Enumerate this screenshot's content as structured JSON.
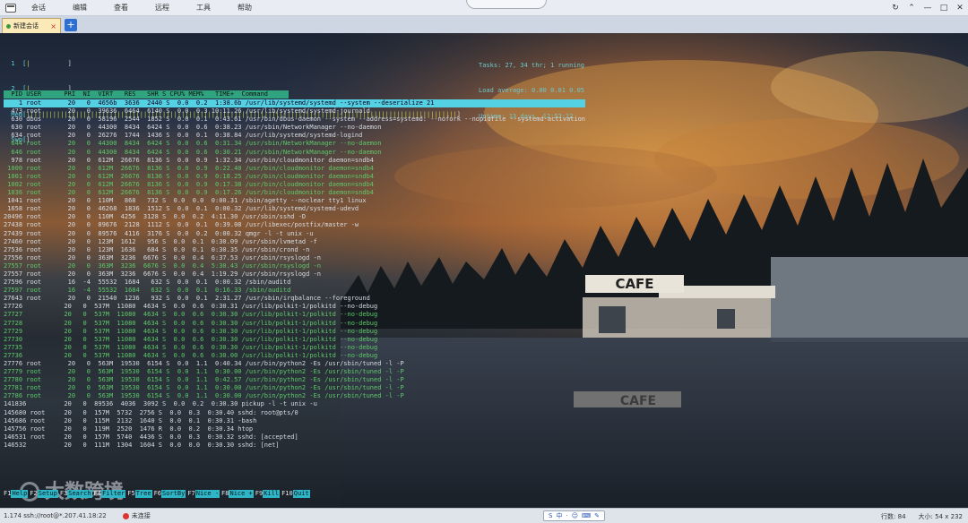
{
  "menu": [
    "会话",
    "编辑",
    "查看",
    "远程",
    "工具",
    "帮助"
  ],
  "tab": {
    "label": "新建会话",
    "close": "×",
    "add": "+"
  },
  "window_controls": [
    "↻",
    "⌃",
    "—",
    "□",
    "✕"
  ],
  "meters": [
    {
      "label": "  1  [",
      "bar": "|",
      "end": "          ]"
    },
    {
      "label": "  2  [",
      "bar": "|",
      "end": "          ]"
    },
    {
      "label": "  Mem[",
      "bar": "||||||||||||||||||||||||||||||||||||||||||||||||||||||||||||||||||||||||||||||||||||||||||||||||||||||||||||||||||",
      "end": "]"
    },
    {
      "label": "  Swp[",
      "bar": "",
      "end": "]"
    }
  ],
  "summary": [
    "Tasks: 27, 34 thr; 1 running",
    "Load average: 0.00 0.01 0.05",
    "Uptime: 13 days, 12:52:12"
  ],
  "process_header": "  PID USER      PRI  NI  VIRT   RES   SHR S CPU% MEM%   TIME+  Command",
  "processes": [
    {
      "line": "    1 root       20   0  4656b  3636  2440 S  0.0  0.2  1:38.6b /usr/lib/systemd/systemd --system --deserialize 21",
      "type": "sel"
    },
    {
      "line": "  473 root       20   0  39636  6464  6140 S  0.0  0.3 10:11.26 /usr/lib/systemd/systemd-journald",
      "type": ""
    },
    {
      "line": "  630 dbus       20   0  58196  2544  1852 S  0.0  0.1  0:43.61 /usr/bin/dbus-daemon --system --address=systemd: --nofork --nopidfile --systemd-activation",
      "type": ""
    },
    {
      "line": "  630 root       20   0  44300  8434  6424 S  0.0  0.6  0:38.23 /usr/sbin/NetworkManager --no-daemon",
      "type": ""
    },
    {
      "line": "  634 root       20   0  26276  1744  1436 S  0.0  0.1  0:38.84 /usr/lib/systemd/systemd-logind",
      "type": ""
    },
    {
      "line": "  644 root       20   0  44300  8434  6424 S  0.0  0.6  0:31.34 /usr/sbin/NetworkManager --no-daemon",
      "type": "thread"
    },
    {
      "line": "  646 root       20   0  44300  8434  6424 S  0.0  0.6  0:30.21 /usr/sbin/NetworkManager --no-daemon",
      "type": "thread"
    },
    {
      "line": "  978 root       20   0  612M  26676  8136 S  0.0  0.9  1:32.34 /usr/bin/cloudmonitor daemon=sndb4",
      "type": ""
    },
    {
      "line": " 1000 root       20   0  612M  26676  8136 S  0.0  0.9  0:22.40 /usr/bin/cloudmonitor daemon=sndb4",
      "type": "thread"
    },
    {
      "line": " 1001 root       20   0  612M  26676  8136 S  0.0  0.9  0:18.25 /usr/bin/cloudmonitor daemon=sndb4",
      "type": "thread"
    },
    {
      "line": " 1002 root       20   0  612M  26676  8136 S  0.0  0.9  0:17.38 /usr/bin/cloudmonitor daemon=sndb4",
      "type": "thread"
    },
    {
      "line": " 1036 root       20   0  612M  26676  8136 S  0.0  0.9  0:17.26 /usr/bin/cloudmonitor daemon=sndb4",
      "type": "thread"
    },
    {
      "line": " 1041 root       20   0  110M   868   732 S  0.0  0.0  0:00.31 /sbin/agetty --noclear tty1 linux",
      "type": ""
    },
    {
      "line": " 1658 root       20   0  46268  1836  1512 S  0.0  0.1  0:00.32 /usr/lib/systemd/systemd-udevd",
      "type": ""
    },
    {
      "line": "20496 root       20   0  110M  4256  3128 S  0.0  0.2  4:11.30 /usr/sbin/sshd -D",
      "type": ""
    },
    {
      "line": "27438 root       20   0  89676  2128  1112 S  0.0  0.1  0:39.08 /usr/libexec/postfix/master -w",
      "type": ""
    },
    {
      "line": "27439 root       20   0  89576  4116  3176 S  0.0  0.2  0:00.32 qmgr -l -t unix -u",
      "type": ""
    },
    {
      "line": "27460 root       20   0  123M  1612   956 S  0.0  0.1  0:30.09 /usr/sbin/lvmetad -f",
      "type": ""
    },
    {
      "line": "27536 root       20   0  123M  1636   684 S  0.0  0.1  0:30.35 /usr/sbin/crond -n",
      "type": ""
    },
    {
      "line": "27556 root       20   0  363M  3236  6676 S  0.0  0.4  6:37.53 /usr/sbin/rsyslogd -n",
      "type": ""
    },
    {
      "line": "27557 root       20   0  363M  3236  6676 S  0.0  0.4  5:30.43 /usr/sbin/rsyslogd -n",
      "type": "thread"
    },
    {
      "line": "27557 root       20   0  363M  3236  6676 S  0.0  0.4  1:19.29 /usr/sbin/rsyslogd -n",
      "type": ""
    },
    {
      "line": "27596 root       16  -4  55532  1684   632 S  0.0  0.1  0:00.32 /sbin/auditd",
      "type": ""
    },
    {
      "line": "27597 root       16  -4  55532  1684   632 S  0.0  0.1  0:16.33 /sbin/auditd",
      "type": "thread"
    },
    {
      "line": "27643 root       20   0  21540  1236   932 S  0.0  0.1  2:31.27 /usr/sbin/irqbalance --foreground",
      "type": ""
    },
    {
      "line": "27726           20   0  537M  11080  4634 S  0.0  0.6  0:30.31 /usr/lib/polkit-1/polkitd --no-debug",
      "type": ""
    },
    {
      "line": "27727           20   0  537M  11080  4634 S  0.0  0.6  0:30.30 /usr/lib/polkit-1/polkitd --no-debug",
      "type": "thread"
    },
    {
      "line": "27728           20   0  537M  11080  4634 S  0.0  0.6  0:30.30 /usr/lib/polkit-1/polkitd --no-debug",
      "type": "thread"
    },
    {
      "line": "27729           20   0  537M  11080  4634 S  0.0  0.6  0:30.30 /usr/lib/polkit-1/polkitd --no-debug",
      "type": "thread"
    },
    {
      "line": "27730           20   0  537M  11080  4634 S  0.0  0.6  0:30.30 /usr/lib/polkit-1/polkitd --no-debug",
      "type": "thread"
    },
    {
      "line": "27735           20   0  537M  11080  4634 S  0.0  0.6  0:30.30 /usr/lib/polkit-1/polkitd --no-debug",
      "type": "thread"
    },
    {
      "line": "27736           20   0  537M  11080  4634 S  0.0  0.6  0:30.00 /usr/lib/polkit-1/polkitd --no-debug",
      "type": "thread"
    },
    {
      "line": "27776 root       20   0  563M  19530  6154 S  0.0  1.1  0:40.34 /usr/bin/python2 -Es /usr/sbin/tuned -l -P",
      "type": ""
    },
    {
      "line": "27779 root       20   0  563M  19530  6154 S  0.0  1.1  0:30.00 /usr/bin/python2 -Es /usr/sbin/tuned -l -P",
      "type": "thread"
    },
    {
      "line": "27780 root       20   0  563M  19530  6154 S  0.0  1.1  0:42.57 /usr/bin/python2 -Es /usr/sbin/tuned -l -P",
      "type": "thread"
    },
    {
      "line": "27781 root       20   0  563M  19530  6154 S  0.0  1.1  0:30.00 /usr/bin/python2 -Es /usr/sbin/tuned -l -P",
      "type": "thread"
    },
    {
      "line": "27786 root       20   0  563M  19530  6154 S  0.0  1.1  0:30.00 /usr/bin/python2 -Es /usr/sbin/tuned -l -P",
      "type": "thread"
    },
    {
      "line": "141836          20   0  89536  4036  3092 S  0.0  0.2  0:30.30 pickup -l -t unix -u",
      "type": ""
    },
    {
      "line": "145680 root     20   0  157M  5732  2756 S  0.0  0.3  0:30.40 sshd: root@pts/0",
      "type": ""
    },
    {
      "line": "145686 root     20   0  115M  2132  1640 S  0.0  0.1  0:30.31 -bash",
      "type": ""
    },
    {
      "line": "145756 root     20   0  119M  2520  1476 R  0.0  0.2  0:30.34 htop",
      "type": ""
    },
    {
      "line": "146531 root     20   0  157M  5740  4436 S  0.0  0.3  0:30.32 sshd: [accepted]",
      "type": ""
    },
    {
      "line": "146532          20   0  111M  1304  1604 S  0.0  0.0  0:30.30 sshd: [net]",
      "type": ""
    }
  ],
  "fn_keys": [
    {
      "key": "F1",
      "label": "Help"
    },
    {
      "key": "F2",
      "label": "Setup"
    },
    {
      "key": "F3",
      "label": "Search"
    },
    {
      "key": "F4",
      "label": "Filter"
    },
    {
      "key": "F5",
      "label": "Tree"
    },
    {
      "key": "F6",
      "label": "SortBy"
    },
    {
      "key": "F7",
      "label": "Nice -"
    },
    {
      "key": "F8",
      "label": "Nice +"
    },
    {
      "key": "F9",
      "label": "Kill"
    },
    {
      "key": "F10",
      "label": "Quit"
    }
  ],
  "scene": {
    "cafe_sign": "CAFE",
    "reflection": "CAFE"
  },
  "watermark": "大数跨境",
  "status": {
    "left": "1.174  ssh://root@*.207.41.18:22",
    "connection": "未连接",
    "ime": [
      "S",
      "中",
      "·",
      "☺",
      "⌨",
      "✎"
    ],
    "right": [
      "行数: 84",
      "大小: 54 x 232"
    ]
  },
  "colors": {
    "selected_row": "#54d2e4",
    "header_row": "#2fa47f",
    "thread_text": "#5fc96a",
    "fn_key_label": "#2fb6c6",
    "meter_bar": "#c9d44a"
  }
}
